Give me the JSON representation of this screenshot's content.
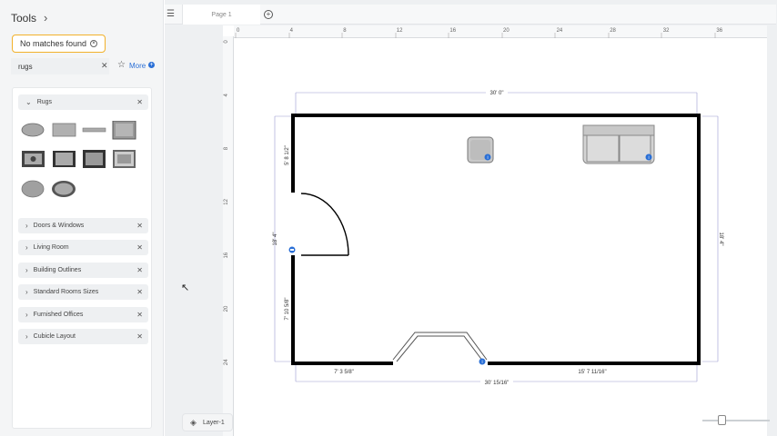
{
  "sidebar": {
    "title": "Tools",
    "tooltip": "No matches found",
    "search": {
      "value": "rugs",
      "placeholder": ""
    },
    "more_label": "More",
    "open_category": "Rugs",
    "categories": [
      "Doors & Windows",
      "Living Room",
      "Building Outlines",
      "Standard Rooms Sizes",
      "Furnished Offices",
      "Cubicle Layout"
    ]
  },
  "tabs": {
    "page_label": "Page 1"
  },
  "layer": {
    "label": "Layer-1"
  },
  "ruler": {
    "top_labels": [
      "0",
      "4",
      "8",
      "12",
      "16",
      "20",
      "24",
      "28",
      "32",
      "36"
    ],
    "left_labels": [
      "0",
      "4",
      "8",
      "12",
      "16",
      "20",
      "24"
    ]
  },
  "floorplan": {
    "top_width": "30' 0\"",
    "bottom_width": "30' 15/16\"",
    "left_height": "18' 4\"",
    "right_height": "18' 4\"",
    "left_upper_segment": "5' 8 1/2\"",
    "left_lower_segment": "7' 10 5/8\"",
    "bottom_left_segment": "7' 3 5/8\"",
    "bottom_right_segment": "15' 7 11/16\""
  },
  "zoom": {
    "level": 0.3
  },
  "colors": {
    "accent": "#2a6fd6",
    "tooltip_border": "#f2b12a",
    "wall": "#000000"
  },
  "icons": [
    "chevron-right-icon",
    "info-icon",
    "close-icon",
    "star-icon",
    "plus-icon",
    "menu-icon",
    "layers-icon",
    "cursor-icon"
  ]
}
